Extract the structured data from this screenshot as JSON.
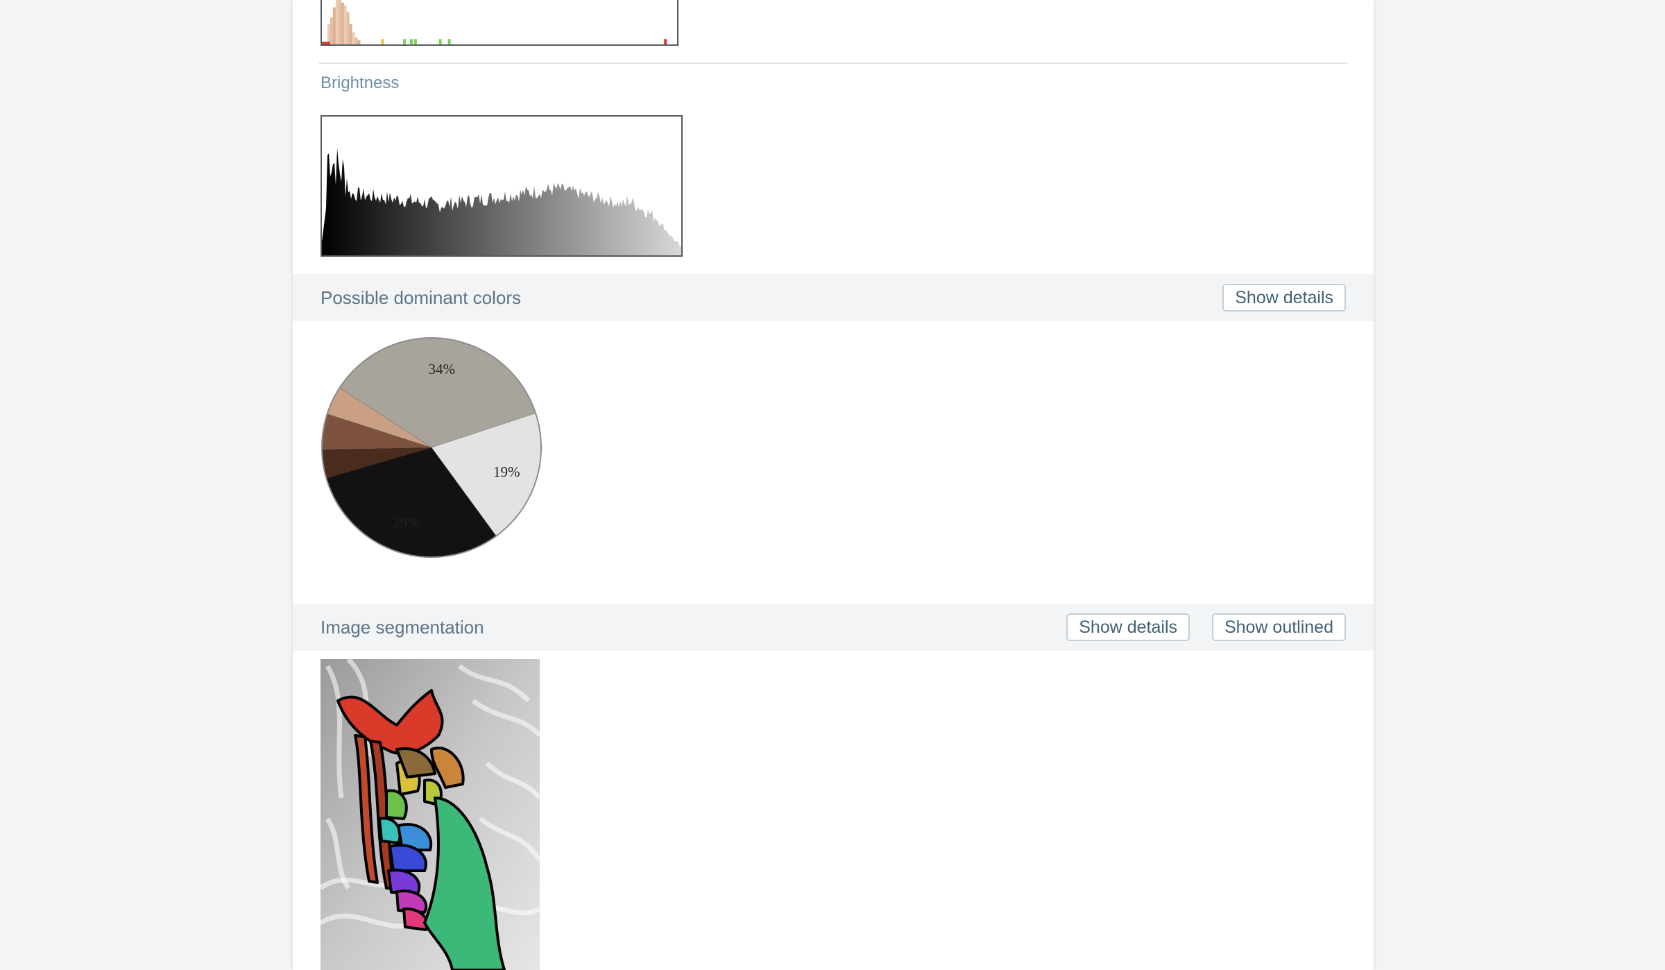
{
  "color_histogram": {
    "colors": [
      "#d9a27a",
      "#e8c24a",
      "#7bd25a",
      "#d83a3a"
    ]
  },
  "brightness": {
    "label": "Brightness"
  },
  "dominant_colors": {
    "title": "Possible dominant colors",
    "show_details_label": "Show details",
    "chart_data": {
      "type": "pie",
      "slices": [
        {
          "label": "34%",
          "value": 34,
          "color": "#a8a49b"
        },
        {
          "label": "19%",
          "value": 19,
          "color": "#e3e3e3"
        },
        {
          "label": "29%",
          "value": 29,
          "color": "#141112"
        },
        {
          "label": "",
          "value": 4,
          "color": "#4a2c1e"
        },
        {
          "label": "",
          "value": 5,
          "color": "#7d5340"
        },
        {
          "label": "",
          "value": 4,
          "color": "#c9a084"
        }
      ]
    }
  },
  "segmentation": {
    "title": "Image segmentation",
    "show_details_label": "Show details",
    "show_outlined_label": "Show outlined"
  }
}
